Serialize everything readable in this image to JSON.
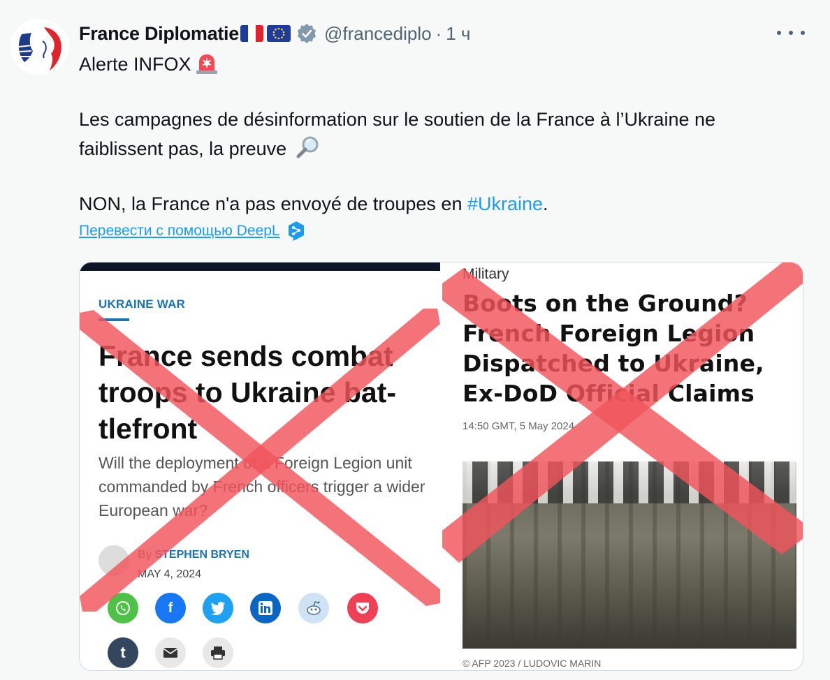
{
  "tweet": {
    "author_name": "France Diplomatie",
    "handle": "@francediplo",
    "separator": "·",
    "time": "1 ч",
    "line1": "Alerte INFOX",
    "line2a": "Les campagnes de désinformation sur le soutien de la France à l’Ukraine ne",
    "line2b": "faiblissent pas, la preuve",
    "line3_prefix": "NON, la France n'a pas envoyé de troupes en ",
    "hashtag": "#Ukraine",
    "line3_suffix": ".",
    "translate_label": "Перевести с помощью DeepL",
    "icons": {
      "verified": "verified-badge-icon",
      "more": "more-icon",
      "siren": "siren-emoji-icon",
      "magnifier": "magnifier-emoji-icon",
      "deepl": "deepl-icon"
    }
  },
  "left_article": {
    "kicker": "UKRAINE WAR",
    "headline": "France sends combat troops to Ukraine bat-tlefront",
    "dek": "Will the deployment of a Foreign Legion unit commanded by French officers trigger a wider European war?",
    "by": "By",
    "author": "STEPHEN BRYEN",
    "date": "MAY 4, 2024",
    "share_icons": [
      "whatsapp-icon",
      "facebook-icon",
      "twitter-icon",
      "linkedin-icon",
      "reddit-icon",
      "pocket-icon",
      "tumblr-icon",
      "email-icon",
      "print-icon"
    ]
  },
  "right_article": {
    "category": "Military",
    "headline": "Boots on the Ground? French Foreign Legion Dispatched to Ukraine, Ex-DoD Official Claims",
    "date": "14:50 GMT, 5 May 2024",
    "credit": "© AFP 2023 / LUDOVIC MARIN"
  },
  "colors": {
    "link": "#1d9bf0",
    "muted": "#536471",
    "x_overlay": "#f0545c",
    "kicker_blue": "#1a73b5"
  }
}
